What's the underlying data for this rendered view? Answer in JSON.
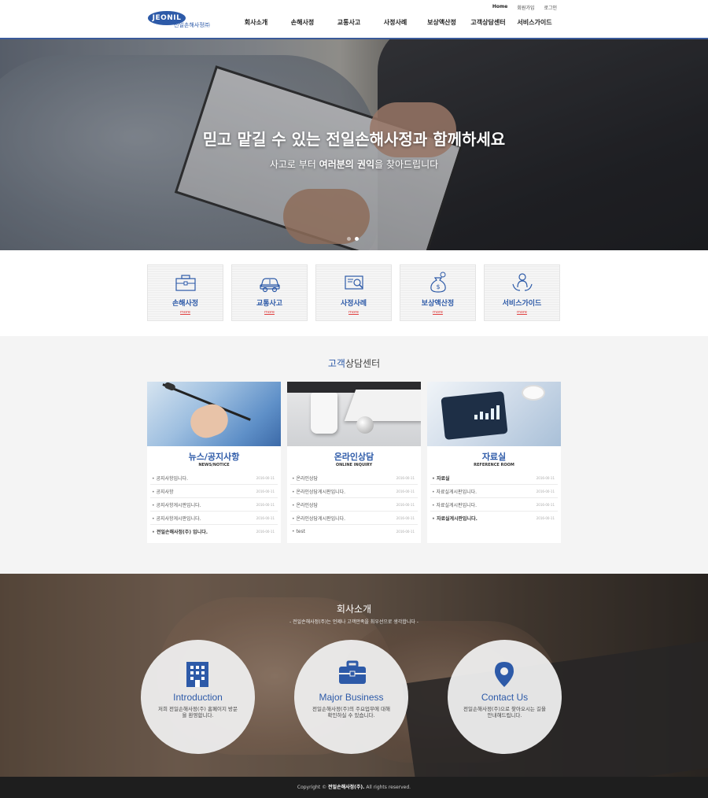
{
  "header": {
    "logo_text": "JEONIL",
    "logo_sub": "전일손해사정㈜",
    "util": {
      "home": "Home",
      "join": "회원가입",
      "login": "로그인"
    },
    "gnb": [
      "회사소개",
      "손해사정",
      "교통사고",
      "사정사례",
      "보상액산정",
      "고객상담센터",
      "서비스가이드"
    ]
  },
  "hero": {
    "title": "믿고 맡길 수 있는 전일손해사정과 함께하세요",
    "sub_pre": "사고로 부터 ",
    "sub_bold": "여러분의 권익",
    "sub_post": "을 찾아드립니다"
  },
  "quick": [
    {
      "label": "손해사정",
      "more": "more",
      "icon": "briefcase-icon"
    },
    {
      "label": "교통사고",
      "more": "more",
      "icon": "car-icon"
    },
    {
      "label": "사정사례",
      "more": "more",
      "icon": "search-document-icon"
    },
    {
      "label": "보상액산정",
      "more": "more",
      "icon": "money-bag-icon"
    },
    {
      "label": "서비스가이드",
      "more": "more",
      "icon": "service-person-icon"
    }
  ],
  "consult": {
    "title_hl": "고객",
    "title_rest": "상담센터",
    "cards": [
      {
        "title": "뉴스/공지사항",
        "sub": "NEWS/NOTICE",
        "items": [
          {
            "text": "공지사항입니다.",
            "date": "2016-00-11",
            "bold": false
          },
          {
            "text": "공지사항",
            "date": "2016-00-11",
            "bold": false
          },
          {
            "text": "공지사항게시판입니다.",
            "date": "2016-00-11",
            "bold": false
          },
          {
            "text": "공지사항게시판입니다.",
            "date": "2016-00-11",
            "bold": false
          },
          {
            "text": "전일손해사정(주) 입니다.",
            "date": "2016-00-11",
            "bold": true
          }
        ]
      },
      {
        "title": "온라인상담",
        "sub": "ONLINE INQUIRY",
        "items": [
          {
            "text": "온라인상담",
            "date": "2016-00-11",
            "bold": false
          },
          {
            "text": "온라인상담게시판입니다.",
            "date": "2016-00-11",
            "bold": false
          },
          {
            "text": "온라인상담",
            "date": "2016-00-11",
            "bold": false
          },
          {
            "text": "온라인상담게시판입니다.",
            "date": "2016-00-11",
            "bold": false
          },
          {
            "text": "test",
            "date": "2016-00-11",
            "bold": false
          }
        ]
      },
      {
        "title": "자료실",
        "sub": "REFERENCE ROOM",
        "items": [
          {
            "text": "자료실",
            "date": "2016-00-11",
            "bold": true
          },
          {
            "text": "자료실게시판입니다.",
            "date": "2016-00-11",
            "bold": false
          },
          {
            "text": "자료실게시판입니다.",
            "date": "2016-00-11",
            "bold": false
          },
          {
            "text": "자료실게시판입니다.",
            "date": "2016-00-11",
            "bold": true
          }
        ]
      }
    ]
  },
  "intro": {
    "title": "회사소개",
    "sub": "- 전일손해사정(주)는 언제나 고객만족을 최우선으로 생각합니다 -",
    "circles": [
      {
        "title": "Introduction",
        "desc": "저희 전일손해사정(주) 홈페이지 방문을 환영합니다.",
        "icon": "building-icon"
      },
      {
        "title": "Major Business",
        "desc": "전일손해사정(주)의 주요업무에 대해 확인하실 수 있습니다.",
        "icon": "briefcase-icon"
      },
      {
        "title": "Contact Us",
        "desc": "전일손해사정(주)으로 찾아오시는 길을 안내해드립니다.",
        "icon": "map-pin-icon"
      }
    ]
  },
  "footer": {
    "pre": "Copyright © ",
    "bold": "전일손해사정(주).",
    "post": " All rights reserved."
  },
  "colors": {
    "brand": "#2d5aa8",
    "more": "#e04040",
    "footer_bg": "#1e1e1e"
  }
}
